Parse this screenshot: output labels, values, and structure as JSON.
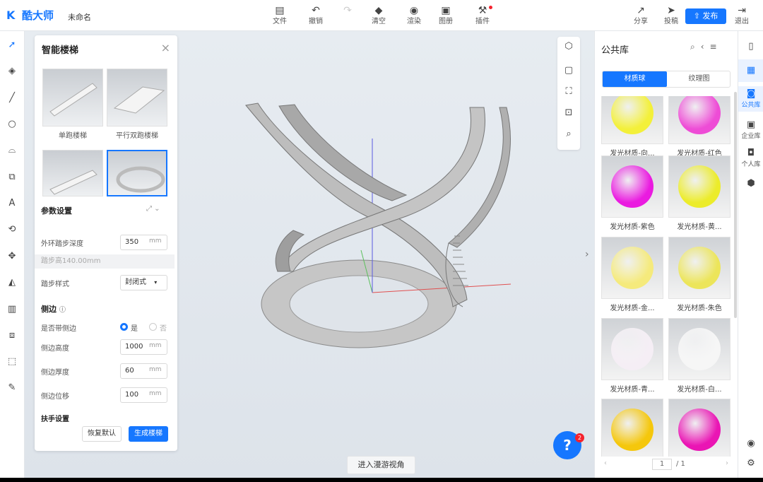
{
  "app": {
    "logo": "酷大师",
    "doc_name": "未命名"
  },
  "toolbar": [
    {
      "label": "文件",
      "icon": "file-icon"
    },
    {
      "label": "撤销",
      "icon": "undo-icon"
    },
    {
      "label": "",
      "icon": "redo-icon",
      "disabled": true
    },
    {
      "label": "清空",
      "icon": "eraser-icon"
    },
    {
      "label": "渲染",
      "icon": "render-icon"
    },
    {
      "label": "图册",
      "icon": "album-icon"
    },
    {
      "label": "插件",
      "icon": "plugin-icon"
    }
  ],
  "right_toolbar": {
    "share": "分享",
    "submit": "投稿",
    "publish": "发布",
    "exit": "退出"
  },
  "panel": {
    "title": "智能楼梯",
    "stairs": [
      {
        "caption": "单跑楼梯"
      },
      {
        "caption": "平行双跑楼梯"
      },
      {
        "caption": ""
      },
      {
        "caption": ""
      }
    ],
    "param_title": "参数设置",
    "outer_depth_label": "外环踏步深度",
    "outer_depth_value": "350",
    "unit": "mm",
    "step_height_hint": "踏步高140.00mm",
    "step_style_label": "踏步样式",
    "step_style_value": "封闭式",
    "side_title": "侧边",
    "has_side_label": "是否带侧边",
    "yes": "是",
    "no": "否",
    "side_height_label": "侧边高度",
    "side_height_value": "1000",
    "side_thick_label": "侧边厚度",
    "side_thick_value": "60",
    "side_offset_label": "侧边位移",
    "side_offset_value": "100",
    "handrail_title": "扶手设置",
    "reset_btn": "恢复默认",
    "generate_btn": "生成楼梯"
  },
  "viewport": {
    "roam_btn": "进入漫游视角",
    "help": "?",
    "help_badge": "2"
  },
  "library": {
    "title": "公共库",
    "tabs": [
      "材质球",
      "纹理图"
    ],
    "materials": [
      {
        "name": "发光材质-向...",
        "color": "#f3f03a"
      },
      {
        "name": "发光材质-红色",
        "color": "#ee4cd6"
      },
      {
        "name": "发光材质-紫色",
        "color": "#ea1be0"
      },
      {
        "name": "发光材质-黄...",
        "color": "#ecec2a"
      },
      {
        "name": "发光材质-金...",
        "color": "#f5ea7c"
      },
      {
        "name": "发光材质-朱色",
        "color": "#ece55a"
      },
      {
        "name": "发光材质-青...",
        "color": "#f5eef5"
      },
      {
        "name": "发光材质-白...",
        "color": "#f6f6f6"
      },
      {
        "name": "",
        "color": "#f5c70c"
      },
      {
        "name": "",
        "color": "#ea15b4"
      }
    ],
    "page": "1",
    "total": "/ 1"
  },
  "right_strip": [
    {
      "label": "",
      "icon": "library-icon"
    },
    {
      "label": "公共库",
      "icon": "public-library-icon",
      "active": true
    },
    {
      "label": "企业库",
      "icon": "enterprise-library-icon"
    },
    {
      "label": "个人库",
      "icon": "personal-library-icon"
    },
    {
      "label": "",
      "icon": "cubes-icon"
    }
  ]
}
